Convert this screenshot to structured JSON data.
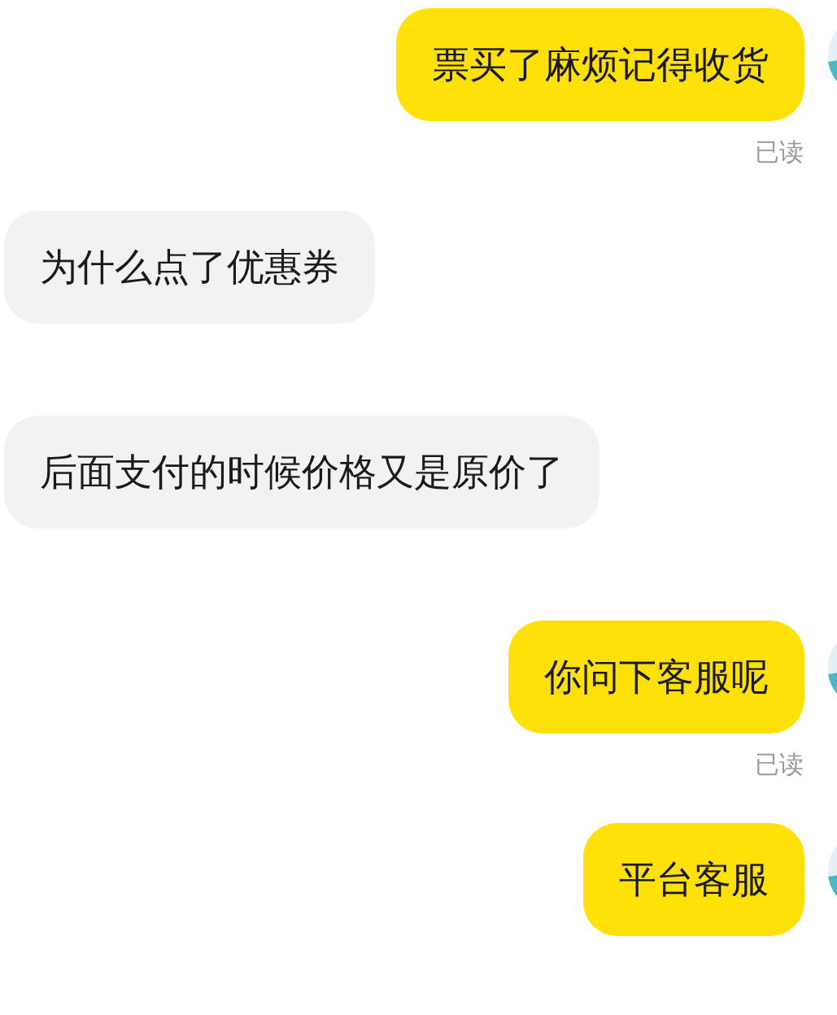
{
  "messages": [
    {
      "kind": "sent",
      "text": "票买了麻烦记得收货",
      "receipt": "已读"
    },
    {
      "kind": "received",
      "text": "为什么点了优惠券"
    },
    {
      "kind": "received",
      "text": "后面支付的时候价格又是原价了"
    },
    {
      "kind": "sent",
      "text": "你问下客服呢",
      "receipt": "已读"
    },
    {
      "kind": "sent",
      "text": "平台客服"
    }
  ]
}
